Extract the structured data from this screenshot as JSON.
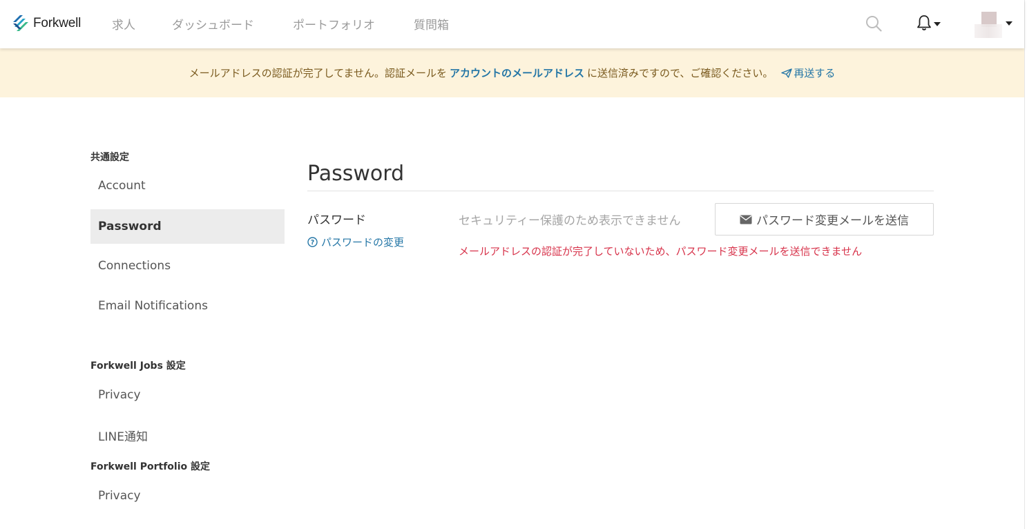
{
  "header": {
    "logo_text": "Forkwell",
    "nav": {
      "jobs": "求人",
      "dashboard": "ダッシュボード",
      "portfolio": "ポートフォリオ",
      "question_box": "質問箱"
    },
    "icons": [
      "search-icon",
      "bell-icon",
      "avatar"
    ]
  },
  "banner": {
    "text_before": "メールアドレスの認証が完了してません。認証メールを",
    "link": "アカウントのメールアドレス",
    "text_after": "に送信済みですので、ご確認ください。",
    "resend": "再送する"
  },
  "sidebar": {
    "common_heading": "共通設定",
    "account": "Account",
    "password": "Password",
    "connections": "Connections",
    "email_notifications": "Email Notifications",
    "jobs_heading": "Forkwell Jobs 設定",
    "privacy_jobs": "Privacy",
    "line": "LINE通知",
    "portfolio_heading": "Forkwell Portfolio 設定",
    "privacy_portfolio": "Privacy",
    "active": "Password"
  },
  "main": {
    "title": "Password",
    "label": "パスワード",
    "change_link": "パスワードの変更",
    "hidden_note": "セキュリティー保護のため表示できません",
    "send_button": "パスワード変更メールを送信",
    "error": "メールアドレスの認証が完了していないため、パスワード変更メールを送信できません"
  },
  "colors": {
    "accent": "#2476a6",
    "banner_bg": "#fdf3dc",
    "banner_text": "#7a5a1e",
    "error": "#d7324a",
    "active_bg": "#ececec"
  }
}
